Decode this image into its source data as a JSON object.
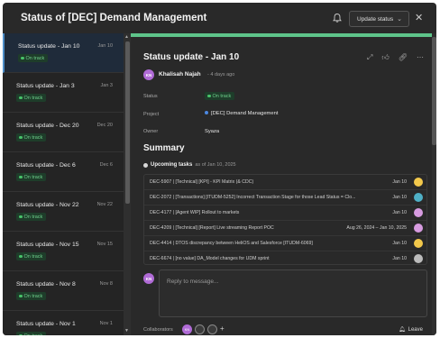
{
  "window": {
    "title": "Status of [DEC] Demand Management",
    "update_button": "Update status",
    "close": "✕"
  },
  "sidebar": {
    "items": [
      {
        "title": "Status update - Jan 10",
        "date": "Jan 10",
        "badge": "On track"
      },
      {
        "title": "Status update - Jan 3",
        "date": "Jan 3",
        "badge": "On track"
      },
      {
        "title": "Status update - Dec 20",
        "date": "Dec 20",
        "badge": "On track"
      },
      {
        "title": "Status update - Dec 6",
        "date": "Dec 6",
        "badge": "On track"
      },
      {
        "title": "Status update - Nov 22",
        "date": "Nov 22",
        "badge": "On track"
      },
      {
        "title": "Status update - Nov 15",
        "date": "Nov 15",
        "badge": "On track"
      },
      {
        "title": "Status update - Nov 8",
        "date": "Nov 8",
        "badge": "On track"
      },
      {
        "title": "Status update - Nov 1",
        "date": "Nov 1",
        "badge": "On track"
      }
    ]
  },
  "detail": {
    "title": "Status update - Jan 10",
    "author": {
      "initials": "KN",
      "name": "Khalisah Najah",
      "time": "- 4 days ago"
    },
    "fields": {
      "status_label": "Status",
      "status_value": "On track",
      "project_label": "Project",
      "project_value": "[DEC] Demand Management",
      "owner_label": "Owner",
      "owner_value": "Syaza"
    },
    "summary_heading": "Summary",
    "upcoming": {
      "label": "Upcoming tasks",
      "suffix": "as of Jan 10, 2025"
    },
    "tasks": [
      {
        "title": "DEC-5907 | [Technical] [KPI] - KPI Matrix (& CDC)",
        "date": "Jan 10",
        "avatar_color": "#f2c84b"
      },
      {
        "title": "DEC-2072 | [Transactions] [ITUDM-5252] Incorrect Transaction Stage for those Lead Status = Clo...",
        "date": "Jan 10",
        "avatar_color": "#4fb0c6"
      },
      {
        "title": "DEC-4177 | [Agent WIP] Rollout to markets",
        "date": "Jan 10",
        "avatar_color": "#d79be0"
      },
      {
        "title": "DEC-4209 | [Technical] [Report] Live streaming Report POC",
        "date": "Aug 26, 2024 – Jan 10, 2025",
        "avatar_color": "#d79be0"
      },
      {
        "title": "DEC-4414 | DTOS discrepancy between HeliOS and Salesforce [ITUDM-6069]",
        "date": "Jan 10",
        "avatar_color": "#f2c84b"
      },
      {
        "title": "DEC-6674 | [no value] DA_Model changes for UDM sprint",
        "date": "Jan 10",
        "avatar_color": "#bbbbbb"
      }
    ],
    "reply_placeholder": "Reply to message...",
    "collaborators_label": "Collaborators",
    "collaborators": [
      {
        "initials": "KN",
        "color": "#b06bd6"
      },
      {
        "initials": "",
        "color": "#3a3a3a"
      },
      {
        "initials": "",
        "color": "#3a3a3a"
      }
    ],
    "add": "+",
    "leave": "Leave"
  },
  "colors": {
    "accent_green": "#5ec48a",
    "on_track": "#48c26a",
    "active_item": "#1f2b3a"
  }
}
